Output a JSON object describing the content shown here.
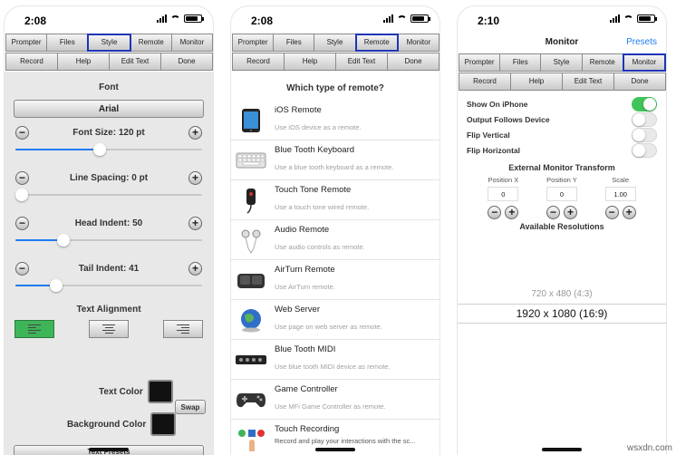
{
  "screens": {
    "style": {
      "time": "2:08",
      "nav_row1": [
        "Prompter",
        "Files",
        "Style",
        "Remote",
        "Monitor"
      ],
      "nav_row2": [
        "Record",
        "Help",
        "Edit Text",
        "Done"
      ],
      "active_tab": "Style",
      "font_label": "Font",
      "font_value": "Arial",
      "font_size_label": "Font Size: 120 pt",
      "line_spacing_label": "Line Spacing: 0 pt",
      "head_indent_label": "Head Indent: 50",
      "tail_indent_label": "Tail Indent: 41",
      "sliders": {
        "font_size": 0.45,
        "line_spacing": 0.0,
        "head_indent": 0.24,
        "tail_indent": 0.2
      },
      "text_alignment_label": "Text Alignment",
      "alignment_selected": "left",
      "text_color_label": "Text Color",
      "background_color_label": "Background Color",
      "swap_label": "Swap",
      "text_presets_label": "Text Presets",
      "text_color": "#111111",
      "background_color": "#111111",
      "minus": "−",
      "plus": "+"
    },
    "remote": {
      "time": "2:08",
      "nav_row1": [
        "Prompter",
        "Files",
        "Style",
        "Remote",
        "Monitor"
      ],
      "nav_row2": [
        "Record",
        "Help",
        "Edit Text",
        "Done"
      ],
      "active_tab": "Remote",
      "title": "Which type of remote?",
      "items": [
        {
          "name": "iOS Remote",
          "desc": "Use iOS device as a remote.",
          "icon": "ipad-icon"
        },
        {
          "name": "Blue Tooth Keyboard",
          "desc": "Use a blue tooth keyboard as a remote.",
          "icon": "keyboard-icon"
        },
        {
          "name": "Touch Tone Remote",
          "desc": "Use a touch tone wired remote.",
          "icon": "touch-tone-remote-icon"
        },
        {
          "name": "Audio Remote",
          "desc": "Use audio controls as remote.",
          "icon": "earphones-icon"
        },
        {
          "name": "AirTurn Remote",
          "desc": "Use AirTurn remote.",
          "icon": "pedal-icon"
        },
        {
          "name": "Web Server",
          "desc": "Use page on web server as remote.",
          "icon": "globe-icon"
        },
        {
          "name": "Blue Tooth MIDI",
          "desc": "Use blue tooth MIDI device as remote.",
          "icon": "midi-controller-icon"
        },
        {
          "name": "Game Controller",
          "desc": "Use MFi Game Controller as remote.",
          "icon": "gamepad-icon"
        },
        {
          "name": "Touch Recording",
          "desc": "Record and play your interactions with the sc...",
          "icon": "touch-recording-icon"
        }
      ]
    },
    "monitor": {
      "time": "2:10",
      "header_title": "Monitor",
      "presets_label": "Presets",
      "nav_row1": [
        "Prompter",
        "Files",
        "Style",
        "Remote",
        "Monitor"
      ],
      "nav_row2": [
        "Record",
        "Help",
        "Edit Text",
        "Done"
      ],
      "active_tab": "Monitor",
      "options": [
        {
          "label": "Show On iPhone",
          "on": true
        },
        {
          "label": "Output Follows Device",
          "on": false
        },
        {
          "label": "Flip Vertical",
          "on": false
        },
        {
          "label": "Flip Horizontal",
          "on": false
        }
      ],
      "transform_title": "External Monitor Transform",
      "transform": [
        {
          "label": "Position X",
          "value": "0"
        },
        {
          "label": "Position Y",
          "value": "0"
        },
        {
          "label": "Scale",
          "value": "1.00"
        }
      ],
      "resolutions_title": "Available Resolutions",
      "resolutions": [
        "720 x 480 (4:3)",
        "1920 x 1080 (16:9)"
      ]
    }
  },
  "watermark": "wsxdn.com",
  "colors": {
    "accent_blue": "#1f7cf2",
    "active_border": "#1f35b5",
    "toggle_green": "#3fc45a",
    "align_green": "#3fb55a"
  }
}
